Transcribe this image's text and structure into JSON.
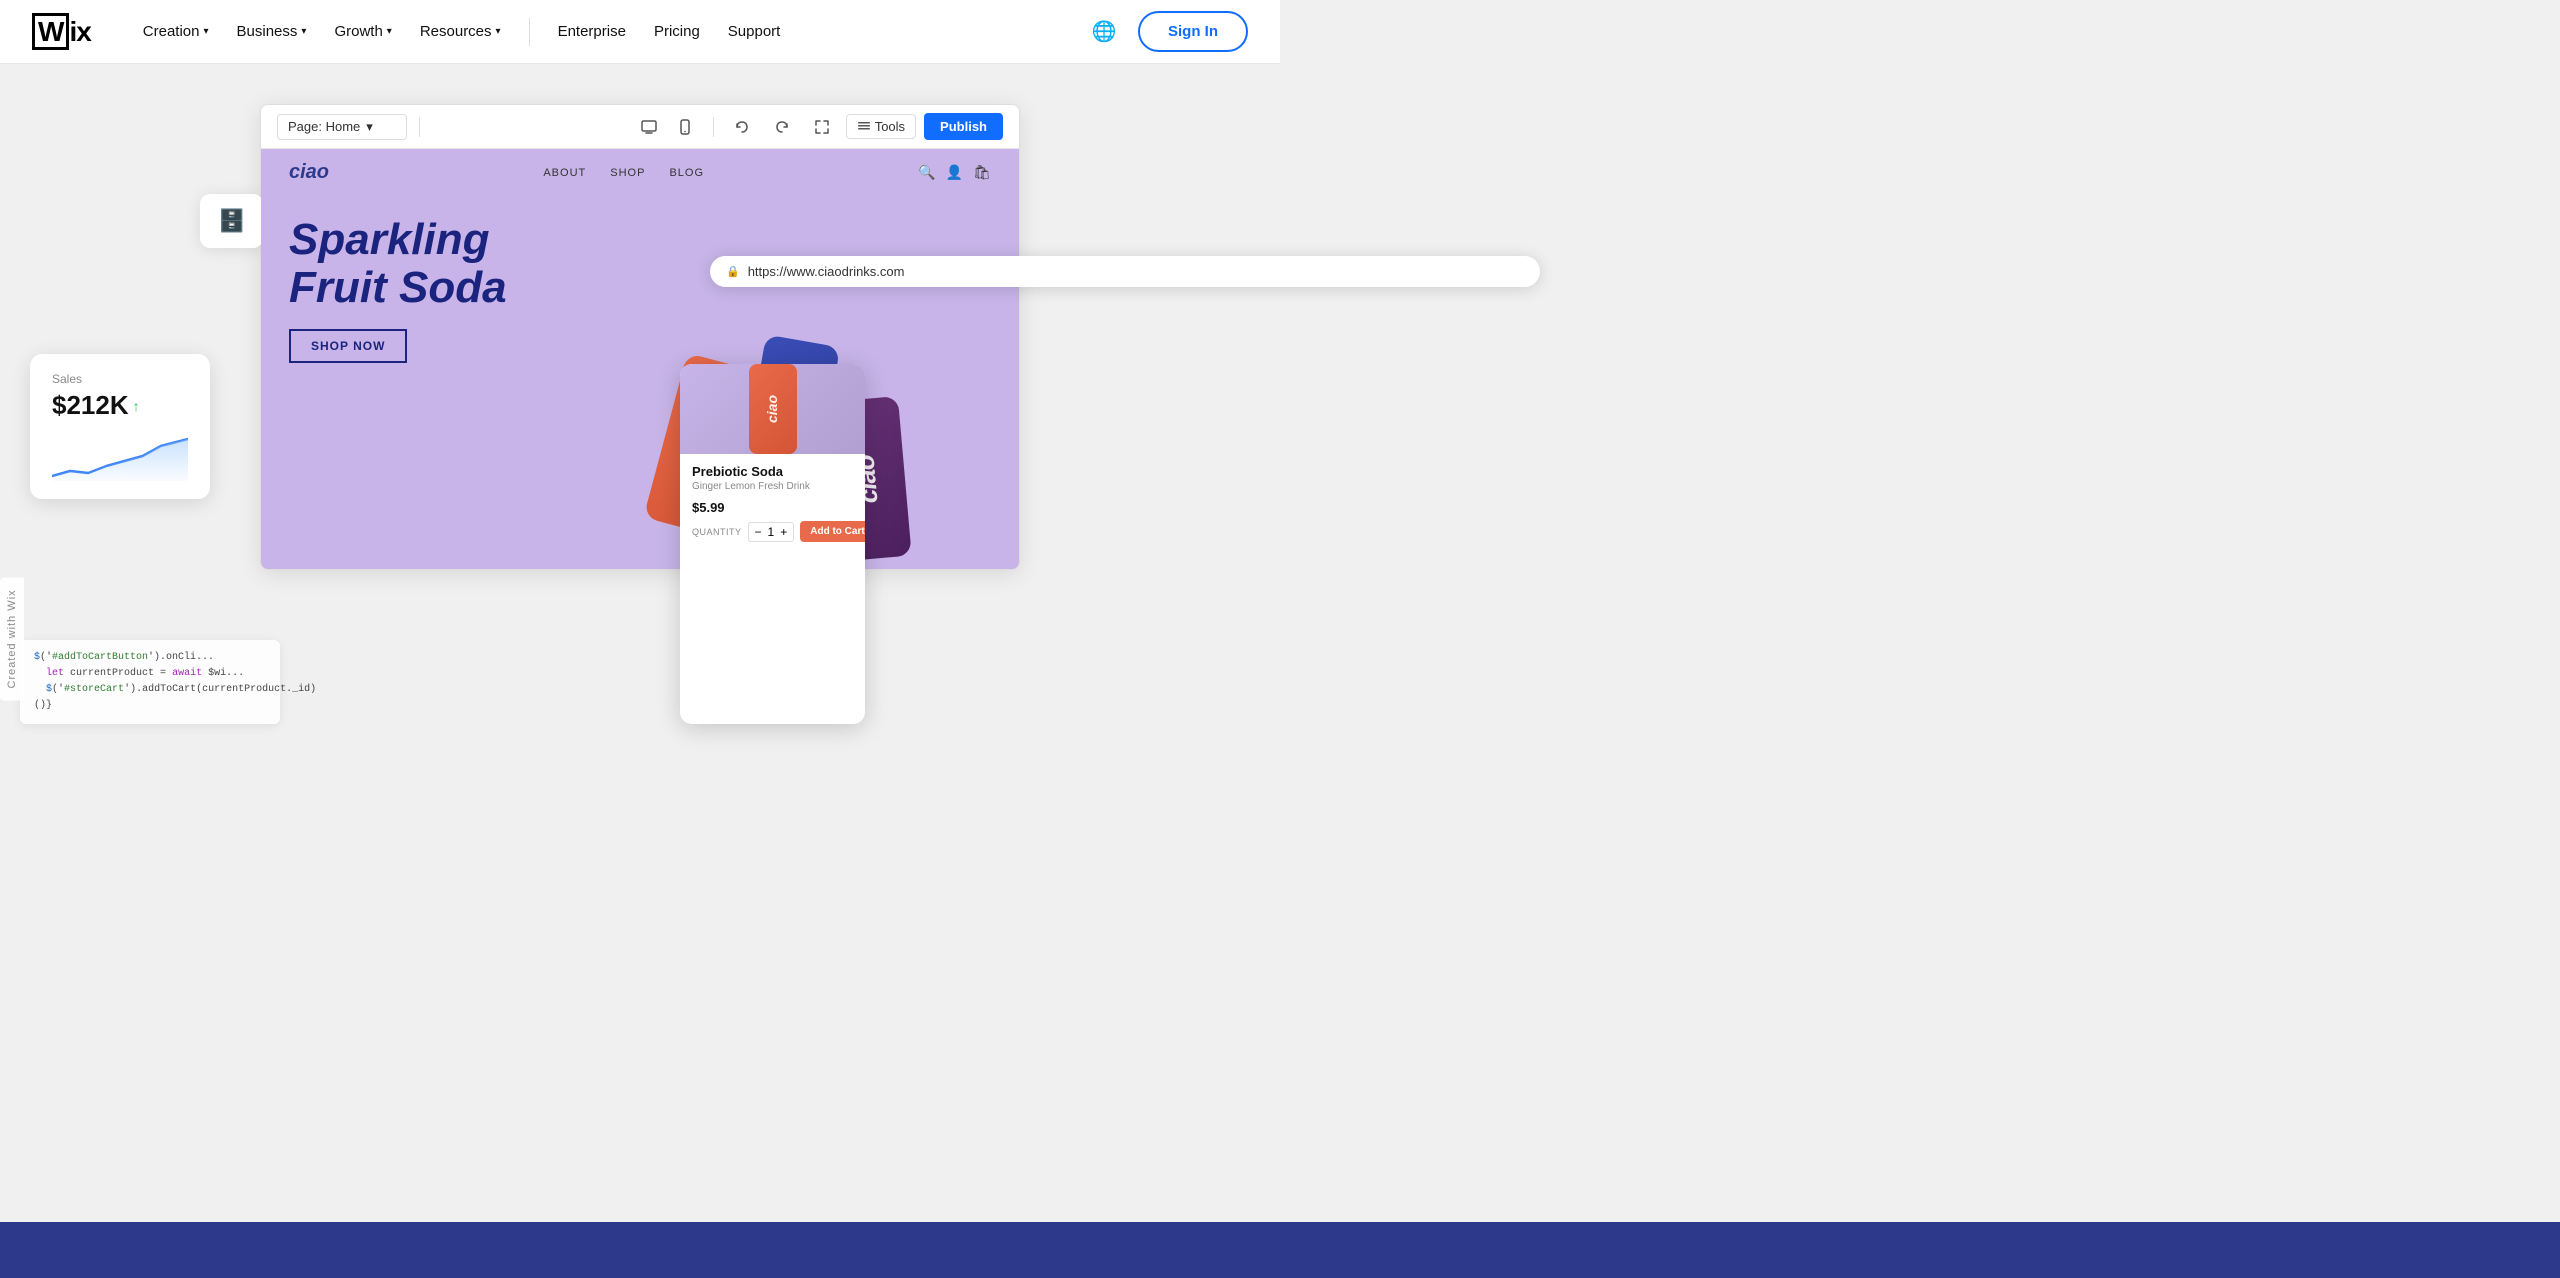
{
  "nav": {
    "logo": "Wix",
    "items": [
      {
        "label": "Creation",
        "hasDropdown": true
      },
      {
        "label": "Business",
        "hasDropdown": true
      },
      {
        "label": "Growth",
        "hasDropdown": true
      },
      {
        "label": "Resources",
        "hasDropdown": true
      },
      {
        "label": "Enterprise",
        "hasDropdown": false
      },
      {
        "label": "Pricing",
        "hasDropdown": false
      },
      {
        "label": "Support",
        "hasDropdown": false
      }
    ],
    "signIn": "Sign In"
  },
  "editor": {
    "pageSelector": "Page: Home",
    "tools": "Tools",
    "publish": "Publish",
    "undoIcon": "↩",
    "redoIcon": "↪"
  },
  "site": {
    "logo": "ciao",
    "navLinks": [
      "ABOUT",
      "SHOP",
      "BLOG"
    ],
    "heroTitle": "Sparkling Fruit Soda",
    "shopNow": "SHOP NOW",
    "url": "https://www.ciaodrinks.com"
  },
  "product": {
    "name": "Prebiotic Soda",
    "subtitle": "Ginger Lemon Fresh Drink",
    "price": "$5.99",
    "quantity": "1",
    "quantityLabel": "QUANTITY",
    "addToCart": "Add to Cart"
  },
  "sales": {
    "label": "Sales",
    "value": "$212K",
    "trend": "↑"
  },
  "code": {
    "line1": "$('#addToCartButton').onCli...",
    "line2": "let currentProduct = await $wi...",
    "line3": "$('#storeCart').addToCart(currentProduct._id)",
    "line4": "()"
  },
  "sideLabel": "Created with Wix",
  "footer": {}
}
